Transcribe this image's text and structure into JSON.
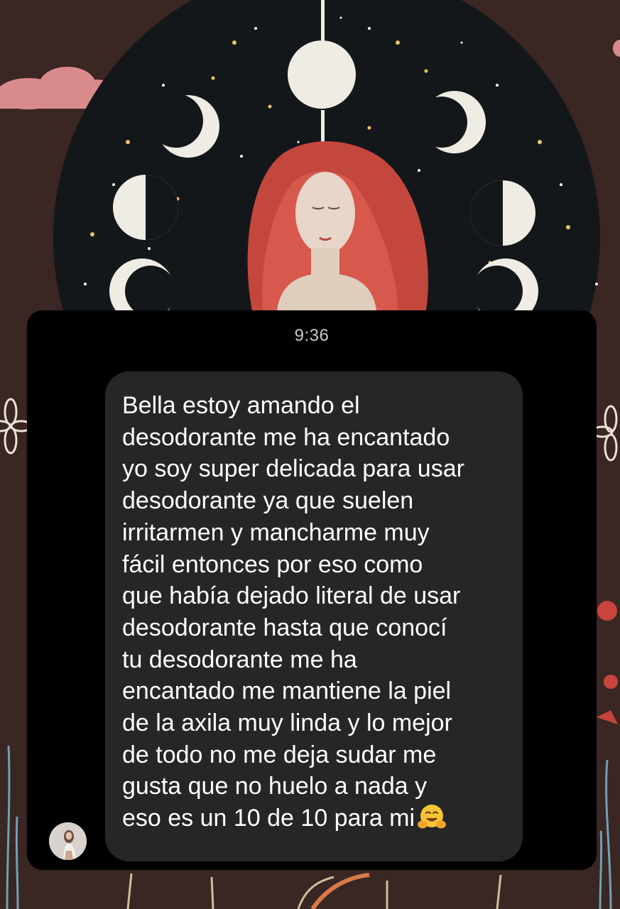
{
  "chat": {
    "timestamp": "9:36",
    "message_lines": [
      "Bella estoy amando el",
      "desodorante me ha encantado",
      "yo soy super delicada para usar",
      "desodorante ya que suelen",
      "irritarmen y mancharme muy",
      "fácil entonces por eso como",
      "que había dejado literal de usar",
      "desodorante hasta que conocí",
      "tu desodorante me ha",
      "encantado me mantiene la piel",
      "de la axila muy linda y lo mejor",
      "de todo no me deja sudar me",
      "gusta que no huelo a nada y",
      "eso es un 10 de 10 para mi"
    ],
    "emoji": "hugging-face-emoji",
    "avatar": "contact-avatar"
  },
  "colors": {
    "card_bg": "#000000",
    "bubble_bg": "#262626",
    "message_text": "#ffffff",
    "timestamp_text": "#c8c8c8",
    "background_art": "#3a2623"
  }
}
